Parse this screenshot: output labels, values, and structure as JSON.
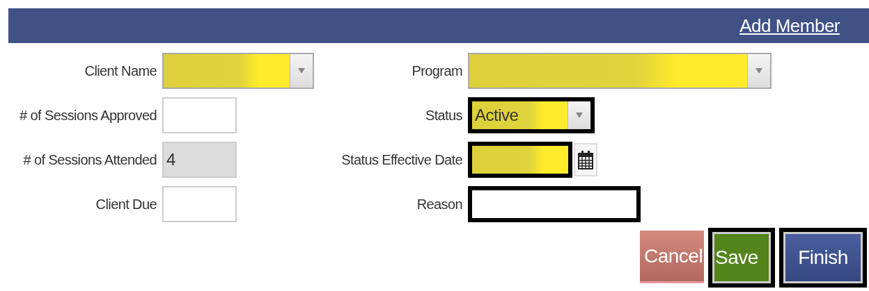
{
  "header": {
    "link": "Add Member"
  },
  "left_fields": [
    {
      "label": "Client Name",
      "kind": "select",
      "highlighted": true,
      "outlined": false,
      "disabled": false
    },
    {
      "label": "# of Sessions Approved",
      "kind": "text",
      "highlighted": false,
      "outlined": false,
      "disabled": false
    },
    {
      "label": "# of Sessions Attended",
      "kind": "text",
      "highlighted": false,
      "outlined": false,
      "disabled": true,
      "value": "4"
    },
    {
      "label": "Client Due",
      "kind": "text",
      "highlighted": false,
      "outlined": false,
      "disabled": false
    }
  ],
  "right_fields": [
    {
      "label": "Program",
      "kind": "select",
      "highlighted": true,
      "outlined": false,
      "disabled": false
    },
    {
      "label": "Status",
      "kind": "select",
      "highlighted": true,
      "outlined": true,
      "disabled": false,
      "value": "Active"
    },
    {
      "label": "Status Effective Date",
      "kind": "date",
      "highlighted": true,
      "outlined": true,
      "disabled": false
    },
    {
      "label": "Reason",
      "kind": "text",
      "highlighted": false,
      "outlined": true,
      "disabled": false
    }
  ],
  "buttons": [
    {
      "label": "Cancel",
      "kind": "cancel",
      "outlined": false
    },
    {
      "label": "Save",
      "kind": "save",
      "outlined": true
    },
    {
      "label": "Finish",
      "kind": "finish",
      "outlined": true
    }
  ]
}
